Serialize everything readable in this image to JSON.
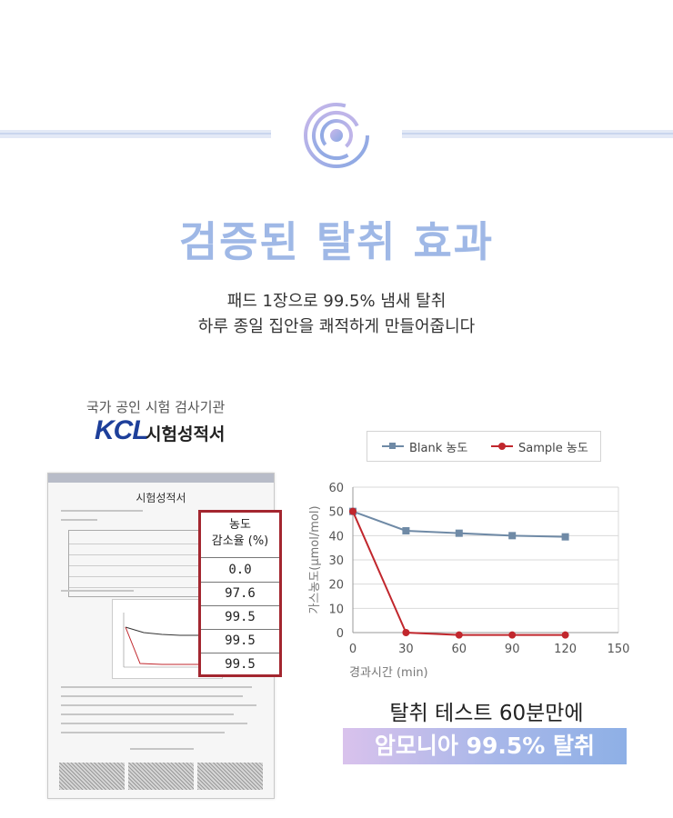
{
  "header": {
    "title": "검증된 탈취 효과",
    "subtitle_line1": "패드 1장으로 99.5% 냄새 탈취",
    "subtitle_line2": "하루 종일 집안을 쾌적하게 만들어줍니다"
  },
  "certificate": {
    "agency_label": "국가 공인 시험 검사기관",
    "logo_text": "KCL",
    "report_label": "시험성적서",
    "document_title": "시험성적서",
    "reduction_table": {
      "header_line1": "농도",
      "header_line2": "감소율 (%)",
      "values": [
        "0.0",
        "97.6",
        "99.5",
        "99.5",
        "99.5"
      ]
    }
  },
  "chart_data": {
    "type": "line",
    "title": "",
    "xlabel": "경과시간 (min)",
    "ylabel": "가스농도(µmol/mol)",
    "xlim": [
      0,
      150
    ],
    "ylim": [
      0,
      60
    ],
    "x_ticks": [
      "0",
      "30",
      "60",
      "90",
      "120",
      "150"
    ],
    "y_ticks": [
      "0",
      "10",
      "20",
      "30",
      "40",
      "50",
      "60"
    ],
    "grid": true,
    "legend_position": "top",
    "series": [
      {
        "name": "Blank 농도",
        "color": "#6f8aa6",
        "marker": "square",
        "x": [
          0,
          30,
          60,
          90,
          120
        ],
        "y": [
          50,
          42,
          41,
          40,
          39.5
        ]
      },
      {
        "name": "Sample 농도",
        "color": "#c1272d",
        "marker": "circle",
        "x": [
          0,
          30,
          60,
          90,
          120
        ],
        "y": [
          50,
          0,
          -1,
          -1,
          -1
        ]
      }
    ]
  },
  "result": {
    "caption": "탈취 테스트 60분만에",
    "banner": "암모니아 99.5% 탈취"
  },
  "colors": {
    "title": "#9fb8e6",
    "table_border": "#a3262f",
    "banner_start": "#d9c2ec",
    "banner_end": "#8eb0e6"
  }
}
